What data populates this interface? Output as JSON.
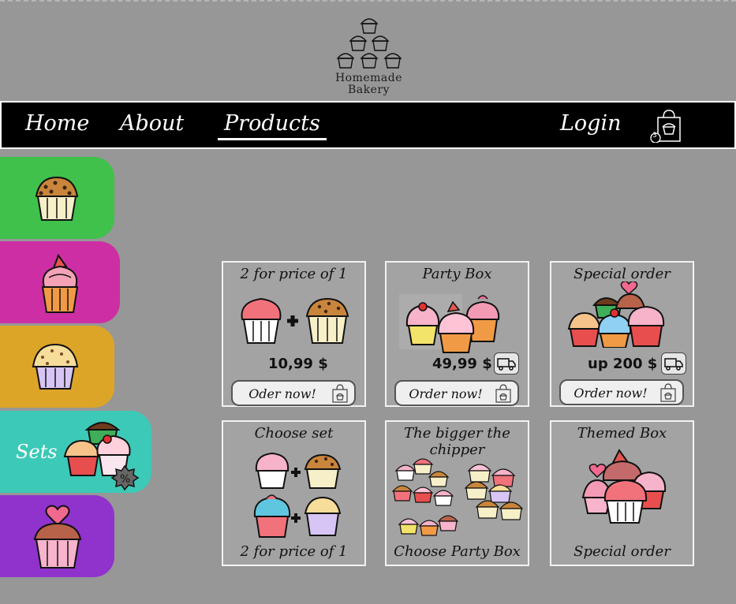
{
  "brand": {
    "name_line1": "Homemade",
    "name_line2": "Bakery"
  },
  "nav": {
    "items": [
      {
        "label": "Home",
        "active": false
      },
      {
        "label": "About",
        "active": false
      },
      {
        "label": "Products",
        "active": true
      }
    ],
    "login_label": "Login",
    "cart_count": "3"
  },
  "categories": [
    {
      "name": "chocolate-chip-muffins",
      "color": "#3fc14b",
      "label": ""
    },
    {
      "name": "fancy-cupcakes",
      "color": "#cd2ea4",
      "label": ""
    },
    {
      "name": "vanilla-muffins",
      "color": "#dda528",
      "label": ""
    },
    {
      "name": "sets",
      "color": "#3cc9b7",
      "label": "Sets"
    },
    {
      "name": "heart-cupcakes",
      "color": "#8f33cc",
      "label": ""
    }
  ],
  "products": [
    {
      "title": "2 for price of 1",
      "price": "10,99 $",
      "button": "Oder now!",
      "delivery": false
    },
    {
      "title": "Party Box",
      "price": "49,99 $",
      "button": "Order now!",
      "delivery": true
    },
    {
      "title": "Special order",
      "price": "up 200 $",
      "button": "Order now!",
      "delivery": true
    },
    {
      "title": "Choose set",
      "bottom": "2 for price of 1"
    },
    {
      "title": "The bigger the chipper",
      "bottom": "Choose Party Box"
    },
    {
      "title": "Themed Box",
      "bottom": "Special order"
    }
  ],
  "colors": {
    "background": "#979797",
    "nav": "#000000",
    "card": "#a3a3a3"
  }
}
